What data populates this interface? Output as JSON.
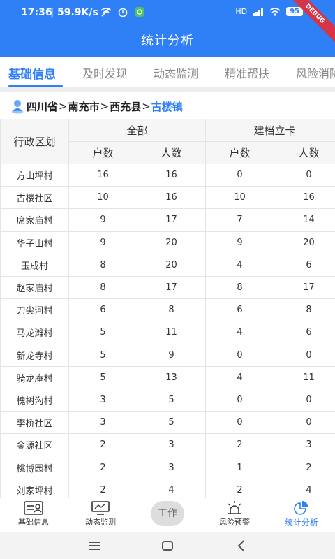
{
  "status_bar": {
    "time": "17:36",
    "speed": "59.9K/s",
    "network": "HD",
    "battery": "95",
    "debug_label": "DEBUG"
  },
  "header": {
    "title": "统计分析"
  },
  "tabs": [
    {
      "label": "基础信息",
      "active": true
    },
    {
      "label": "及时发现",
      "active": false
    },
    {
      "label": "动态监测",
      "active": false
    },
    {
      "label": "精准帮扶",
      "active": false
    },
    {
      "label": "风险消除",
      "active": false
    }
  ],
  "breadcrumb": {
    "province": "四川省",
    "city": "南充市",
    "county": "西充县",
    "town": "古楼镇",
    "separator": ">"
  },
  "table": {
    "region_header": "行政区划",
    "group_all": "全部",
    "group_registered": "建档立卡",
    "col_households": "户数",
    "col_people": "人数",
    "rows": [
      {
        "name": "方山坪村",
        "all_h": "16",
        "all_p": "16",
        "reg_h": "0",
        "reg_p": "0"
      },
      {
        "name": "古楼社区",
        "all_h": "10",
        "all_p": "16",
        "reg_h": "10",
        "reg_p": "16"
      },
      {
        "name": "席家庙村",
        "all_h": "9",
        "all_p": "17",
        "reg_h": "7",
        "reg_p": "14"
      },
      {
        "name": "华子山村",
        "all_h": "9",
        "all_p": "20",
        "reg_h": "9",
        "reg_p": "20"
      },
      {
        "name": "玉成村",
        "all_h": "8",
        "all_p": "20",
        "reg_h": "4",
        "reg_p": "6"
      },
      {
        "name": "赵家庙村",
        "all_h": "8",
        "all_p": "17",
        "reg_h": "8",
        "reg_p": "17"
      },
      {
        "name": "刀尖河村",
        "all_h": "6",
        "all_p": "8",
        "reg_h": "6",
        "reg_p": "8"
      },
      {
        "name": "马龙滩村",
        "all_h": "5",
        "all_p": "11",
        "reg_h": "4",
        "reg_p": "6"
      },
      {
        "name": "新龙寺村",
        "all_h": "5",
        "all_p": "9",
        "reg_h": "0",
        "reg_p": "0"
      },
      {
        "name": "骑龙庵村",
        "all_h": "5",
        "all_p": "13",
        "reg_h": "4",
        "reg_p": "11"
      },
      {
        "name": "槐树沟村",
        "all_h": "3",
        "all_p": "5",
        "reg_h": "0",
        "reg_p": "0"
      },
      {
        "name": "李桥社区",
        "all_h": "3",
        "all_p": "5",
        "reg_h": "0",
        "reg_p": "0"
      },
      {
        "name": "金源社区",
        "all_h": "2",
        "all_p": "3",
        "reg_h": "2",
        "reg_p": "3"
      },
      {
        "name": "桃博园村",
        "all_h": "2",
        "all_p": "3",
        "reg_h": "1",
        "reg_p": "2"
      },
      {
        "name": "刘家坪村",
        "all_h": "2",
        "all_p": "4",
        "reg_h": "2",
        "reg_p": "4"
      }
    ]
  },
  "bottom_nav": {
    "items": [
      {
        "label": "基础信息",
        "icon": "id-card-icon"
      },
      {
        "label": "动态监测",
        "icon": "monitor-chart-icon"
      },
      {
        "label": "风险预警",
        "icon": "alarm-light-icon"
      },
      {
        "label": "统计分析",
        "icon": "pie-chart-icon",
        "active": true
      }
    ],
    "center_label": "工作"
  },
  "colors": {
    "primary": "#2f7ff6",
    "tab_inactive": "#8a8a8a",
    "debug": "#d63447"
  }
}
